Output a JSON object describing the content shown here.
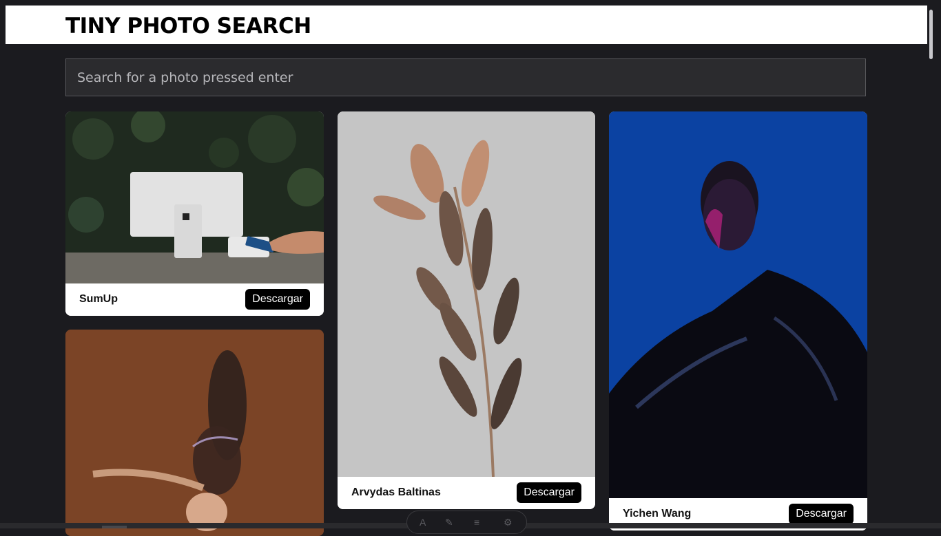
{
  "app": {
    "title": "TINY PHOTO SEARCH"
  },
  "search": {
    "placeholder": "Search for a photo pressed enter",
    "value": ""
  },
  "cards": [
    {
      "author": "SumUp",
      "button_label": "Descargar",
      "photo_icon": "pos-terminal-photo-icon"
    },
    {
      "author": "Arvydas Baltinas",
      "button_label": "Descargar",
      "photo_icon": "dried-plant-photo-icon"
    },
    {
      "author": "Yichen Wang",
      "button_label": "Descargar",
      "photo_icon": "portrait-photo-icon"
    },
    {
      "author": "",
      "button_label": "",
      "photo_icon": "dancer-photo-icon"
    }
  ],
  "colors": {
    "page_background": "#1b1b1f",
    "header_background": "#ffffff",
    "button_background": "#000000",
    "search_background": "#2b2b2e"
  }
}
